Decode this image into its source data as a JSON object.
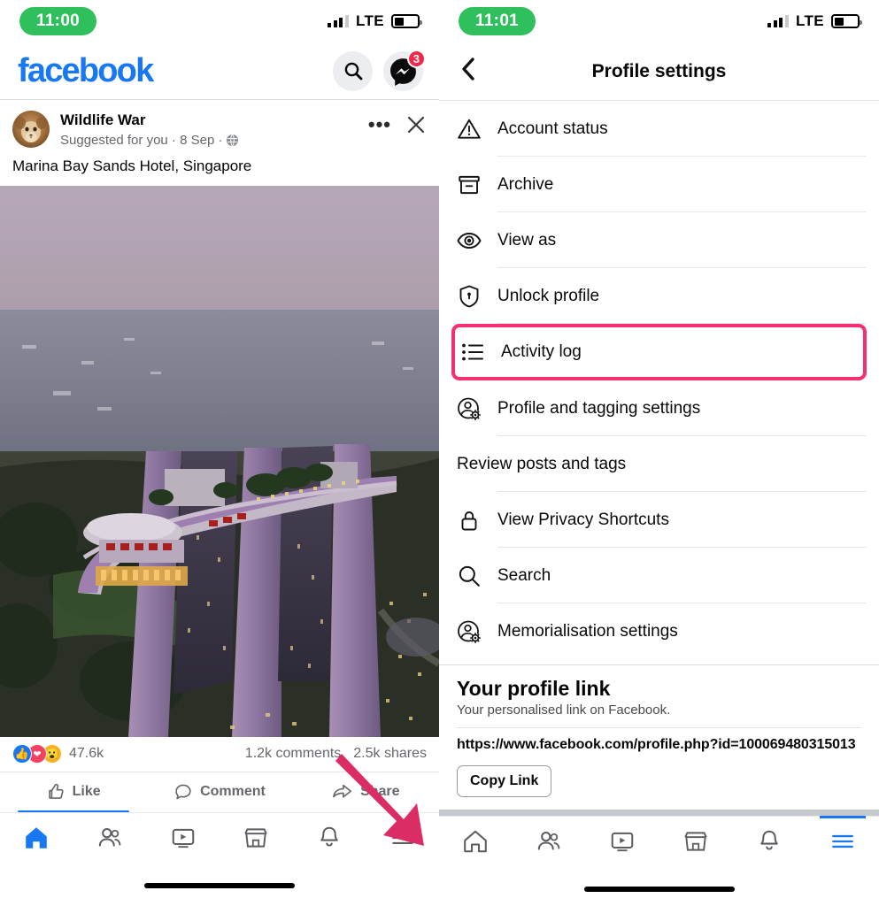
{
  "left": {
    "status": {
      "time": "11:00",
      "network": "LTE",
      "signal_bars": 4,
      "signal_filled": 3,
      "battery_percent": 40
    },
    "header": {
      "wordmark": "facebook",
      "search_icon": "search-icon",
      "messenger_icon": "messenger-icon",
      "messenger_badge": "3"
    },
    "post": {
      "author": "Wildlife War",
      "subtitle": "Suggested for you · 8 Sep ·",
      "privacy_icon": "globe-icon",
      "more_icon": "ellipsis-icon",
      "close_icon": "close-icon",
      "caption": "Marina Bay Sands Hotel, Singapore",
      "photo_alt": "Marina Bay Sands Hotel aerial view at dusk, Singapore",
      "reaction_count": "47.6k",
      "comments": "1.2k comments",
      "shares": "2.5k shares",
      "reactions": [
        "like-reaction",
        "love-reaction",
        "wow-reaction"
      ],
      "actions": [
        {
          "label": "Like",
          "icon": "thumbs-up-icon",
          "active": true
        },
        {
          "label": "Comment",
          "icon": "comment-bubble-icon",
          "active": false
        },
        {
          "label": "Share",
          "icon": "share-arrow-icon",
          "active": false
        }
      ]
    },
    "nav": [
      {
        "name": "home",
        "icon": "home-icon",
        "active": true
      },
      {
        "name": "friends",
        "icon": "friends-icon",
        "active": false
      },
      {
        "name": "video",
        "icon": "video-icon",
        "active": false
      },
      {
        "name": "marketplace",
        "icon": "marketplace-icon",
        "active": false
      },
      {
        "name": "notifications",
        "icon": "bell-icon",
        "active": false
      },
      {
        "name": "menu",
        "icon": "hamburger-menu-icon",
        "active": false
      }
    ]
  },
  "right": {
    "status": {
      "time": "11:01",
      "network": "LTE",
      "signal_bars": 4,
      "signal_filled": 3,
      "battery_percent": 40
    },
    "header": {
      "back_icon": "back-chevron-icon",
      "title": "Profile settings"
    },
    "settings": [
      {
        "label": "Account status",
        "icon": "warning-triangle-icon",
        "highlighted": false,
        "has_icon": true
      },
      {
        "label": "Archive",
        "icon": "archive-box-icon",
        "highlighted": false,
        "has_icon": true
      },
      {
        "label": "View as",
        "icon": "eye-icon",
        "highlighted": false,
        "has_icon": true
      },
      {
        "label": "Unlock profile",
        "icon": "shield-lock-icon",
        "highlighted": false,
        "has_icon": true
      },
      {
        "label": "Activity log",
        "icon": "activity-list-icon",
        "highlighted": true,
        "has_icon": true
      },
      {
        "label": "Profile and tagging settings",
        "icon": "profile-gear-icon",
        "highlighted": false,
        "has_icon": true
      },
      {
        "label": "Review posts and tags",
        "icon": "",
        "highlighted": false,
        "has_icon": false
      },
      {
        "label": "View Privacy Shortcuts",
        "icon": "padlock-icon",
        "highlighted": false,
        "has_icon": true
      },
      {
        "label": "Search",
        "icon": "search-icon",
        "highlighted": false,
        "has_icon": true
      },
      {
        "label": "Memorialisation settings",
        "icon": "profile-gear-icon",
        "highlighted": false,
        "has_icon": true
      }
    ],
    "profile_link": {
      "heading": "Your profile link",
      "description": "Your personalised link on Facebook.",
      "url": "https://www.facebook.com/profile.php?id=100069480315013",
      "copy_label": "Copy Link"
    },
    "nav": [
      {
        "name": "home",
        "icon": "home-icon",
        "active": false
      },
      {
        "name": "friends",
        "icon": "friends-icon",
        "active": false
      },
      {
        "name": "video",
        "icon": "video-icon",
        "active": false
      },
      {
        "name": "marketplace",
        "icon": "marketplace-icon",
        "active": false
      },
      {
        "name": "notifications",
        "icon": "bell-icon",
        "active": false
      },
      {
        "name": "menu",
        "icon": "hamburger-menu-icon",
        "active": true
      }
    ]
  },
  "annotation": {
    "arrow_icon": "pointer-arrow-annotation",
    "arrow_color": "#DB2D63",
    "highlight_color": "#F5306F"
  }
}
